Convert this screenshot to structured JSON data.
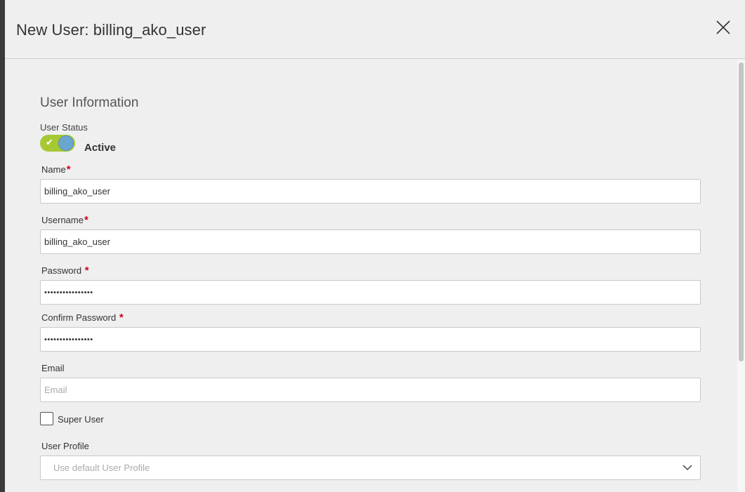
{
  "modal": {
    "title": "New User: billing_ako_user"
  },
  "section": {
    "title": "User Information"
  },
  "user_status": {
    "label": "User Status",
    "value": "Active",
    "enabled": true
  },
  "fields": {
    "name": {
      "label": "Name",
      "value": "billing_ako_user",
      "required": "*"
    },
    "username": {
      "label": "Username",
      "value": "billing_ako_user",
      "required": "*"
    },
    "password": {
      "label": "Password",
      "value": "••••••••••••••••",
      "required": "*"
    },
    "confirm_password": {
      "label": "Confirm Password",
      "value": "••••••••••••••••",
      "required": "*"
    },
    "email": {
      "label": "Email",
      "value": "",
      "placeholder": "Email"
    }
  },
  "super_user": {
    "label": "Super User",
    "checked": false
  },
  "user_profile": {
    "label": "User Profile",
    "placeholder": "Use default User Profile"
  },
  "colors": {
    "toggle_on": "#a6c833",
    "toggle_knob": "#6aa6d0",
    "required": "#d0021b"
  },
  "icons": {
    "close": "close-icon",
    "check": "check-icon",
    "chevron": "chevron-down-icon"
  }
}
